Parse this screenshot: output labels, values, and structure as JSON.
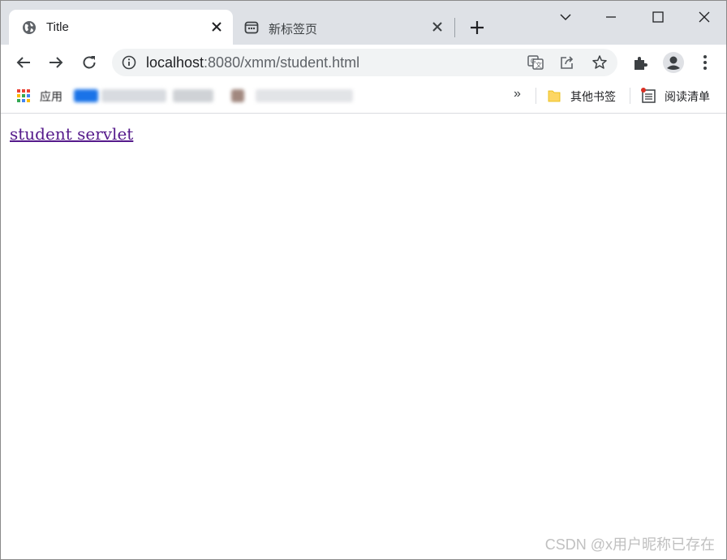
{
  "tabs": [
    {
      "title": "Title",
      "active": true,
      "icon": "globe-icon"
    },
    {
      "title": "新标签页",
      "active": false,
      "icon": "new-tab-page-icon"
    }
  ],
  "window_controls": [
    "dropdown-chevron-icon",
    "minimize-icon",
    "maximize-icon",
    "close-icon"
  ],
  "toolbar": {
    "url_host": "localhost",
    "url_rest": ":8080/xmm/student.html",
    "actions": [
      "translate-icon",
      "share-icon",
      "bookmark-star-icon"
    ],
    "right": [
      "extensions-icon",
      "profile-avatar-icon",
      "more-menu-icon"
    ]
  },
  "bookmarks": {
    "apps_label": "应用",
    "overflow": "»",
    "other_bookmarks": "其他书签",
    "reading_list": "阅读清单"
  },
  "page": {
    "link_text": "student servlet"
  },
  "watermark": "CSDN @x用户昵称已存在",
  "colors": {
    "tabstrip": "#dee1e6",
    "visited_link": "#551a8b",
    "omnibox": "#f1f3f4"
  }
}
